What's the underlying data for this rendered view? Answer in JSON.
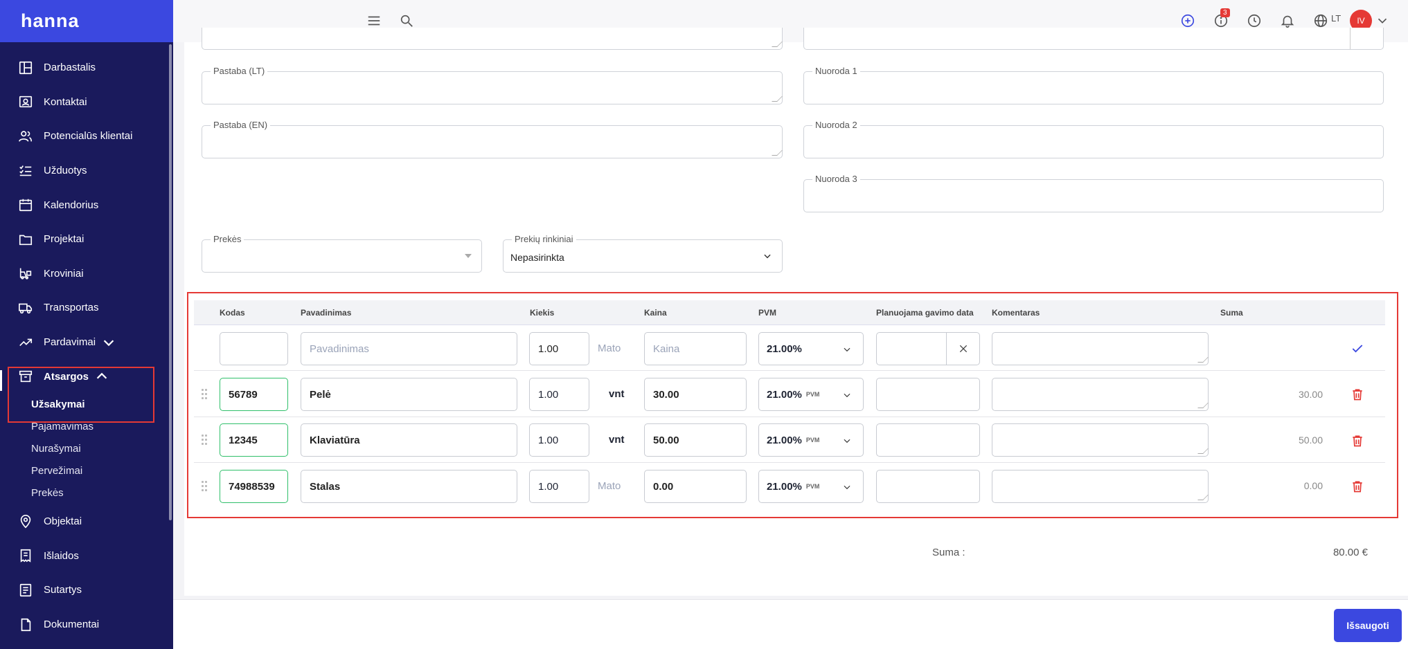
{
  "app": {
    "logo": "hanna",
    "lang": "LT",
    "avatar": "IV",
    "notif_badge": "3"
  },
  "colors": {
    "sidebar": "#1a1a5c",
    "brand": "#3b48e0",
    "danger": "#e53935",
    "valid": "#2fbf6a"
  },
  "sidebar": {
    "items": [
      {
        "label": "Darbastalis",
        "icon": "dashboard-icon"
      },
      {
        "label": "Kontaktai",
        "icon": "contact-card-icon"
      },
      {
        "label": "Potencialūs klientai",
        "icon": "users-icon"
      },
      {
        "label": "Užduotys",
        "icon": "checklist-icon"
      },
      {
        "label": "Kalendorius",
        "icon": "calendar-icon"
      },
      {
        "label": "Projektai",
        "icon": "folder-icon"
      },
      {
        "label": "Kroviniai",
        "icon": "forklift-icon"
      },
      {
        "label": "Transportas",
        "icon": "truck-icon"
      },
      {
        "label": "Pardavimai",
        "icon": "trend-icon"
      },
      {
        "label": "Atsargos",
        "icon": "archive-icon"
      }
    ],
    "subitems": [
      "Užsakymai",
      "Pajamavimas",
      "Nurašymai",
      "Pervežimai",
      "Prekės"
    ],
    "items_after": [
      {
        "label": "Objektai",
        "icon": "location-icon"
      },
      {
        "label": "Išlaidos",
        "icon": "receipt-icon"
      },
      {
        "label": "Sutartys",
        "icon": "contract-icon"
      },
      {
        "label": "Dokumentai",
        "icon": "document-icon"
      }
    ]
  },
  "form": {
    "pastaba_lt": "Pastaba (LT)",
    "pastaba_en": "Pastaba (EN)",
    "nuoroda1": "Nuoroda 1",
    "nuoroda2": "Nuoroda 2",
    "nuoroda3": "Nuoroda 3",
    "prekes": "Prekės",
    "rinkiniai": "Prekių rinkiniai",
    "rinkiniai_value": "Nepasirinkta"
  },
  "table": {
    "headers": [
      "Kodas",
      "Pavadinimas",
      "Kiekis",
      "Kaina",
      "PVM",
      "Planuojama gavimo data",
      "Komentaras",
      "Suma"
    ],
    "new_row": {
      "name_placeholder": "Pavadinimas",
      "qty": "1.00",
      "unit_placeholder": "Mato",
      "price_placeholder": "Kaina",
      "vat": "21.00%"
    },
    "rows": [
      {
        "code": "56789",
        "name": "Pelė",
        "qty": "1.00",
        "unit": "vnt",
        "price": "30.00",
        "vat": "21.00%",
        "vat_tag": "PVM",
        "sum": "30.00"
      },
      {
        "code": "12345",
        "name": "Klaviatūra",
        "qty": "1.00",
        "unit": "vnt",
        "price": "50.00",
        "vat": "21.00%",
        "vat_tag": "PVM",
        "sum": "50.00"
      },
      {
        "code": "74988539",
        "name": "Stalas",
        "qty": "1.00",
        "unit": "Mato",
        "price": "0.00",
        "vat": "21.00%",
        "vat_tag": "PVM",
        "sum": "0.00"
      }
    ]
  },
  "totals": {
    "label": "Suma :",
    "value": "80.00 €"
  },
  "actions": {
    "save": "Išsaugoti"
  }
}
